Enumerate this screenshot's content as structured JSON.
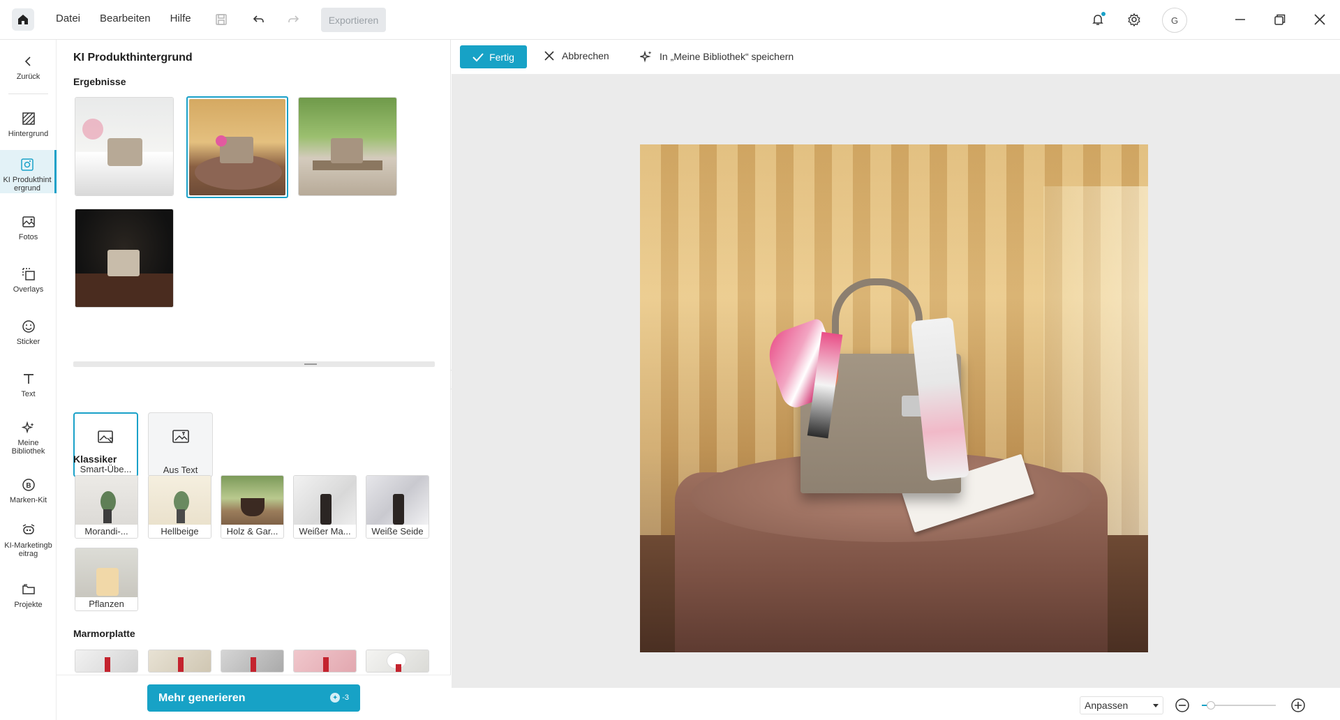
{
  "topbar": {
    "menu": [
      "Datei",
      "Bearbeiten",
      "Hilfe"
    ],
    "export_label": "Exportieren",
    "avatar_initial": "G"
  },
  "rail": [
    {
      "label": "Zurück",
      "icon": "chevron-left-icon"
    },
    {
      "label": "Hintergrund",
      "icon": "background-icon"
    },
    {
      "label": "KI Produkthint ergrund",
      "icon": "ai-product-background-icon",
      "active": true
    },
    {
      "label": "Fotos",
      "icon": "photo-icon"
    },
    {
      "label": "Overlays",
      "icon": "overlays-icon"
    },
    {
      "label": "Sticker",
      "icon": "sticker-icon"
    },
    {
      "label": "Text",
      "icon": "text-icon"
    },
    {
      "label": "Meine Bibliothek",
      "icon": "sparkle-library-icon"
    },
    {
      "label": "Marken-Kit",
      "icon": "brand-kit-icon"
    },
    {
      "label": "KI-Marketingb eitrag",
      "icon": "ai-marketing-icon"
    },
    {
      "label": "Projekte",
      "icon": "folder-icon"
    }
  ],
  "panel": {
    "title": "KI Produkthintergrund",
    "results_title": "Ergebnisse",
    "modes": [
      "Smart-Übe...",
      "Aus Text"
    ],
    "classics_title": "Klassiker",
    "classics": [
      "Morandi-...",
      "Hellbeige",
      "Holz & Gar...",
      "Weißer Ma...",
      "Weiße Seide",
      "Pflanzen"
    ],
    "marble_title": "Marmorplatte",
    "generate_label": "Mehr generieren",
    "credit_cost": "-3"
  },
  "toolbar": {
    "done_label": "Fertig",
    "cancel_label": "Abbrechen",
    "save_label": "In „Meine Bibliothek“ speichern"
  },
  "bottombar": {
    "fit_label": "Anpassen",
    "zoom_fraction": 0.12
  },
  "colors": {
    "accent": "#17a2c6"
  }
}
